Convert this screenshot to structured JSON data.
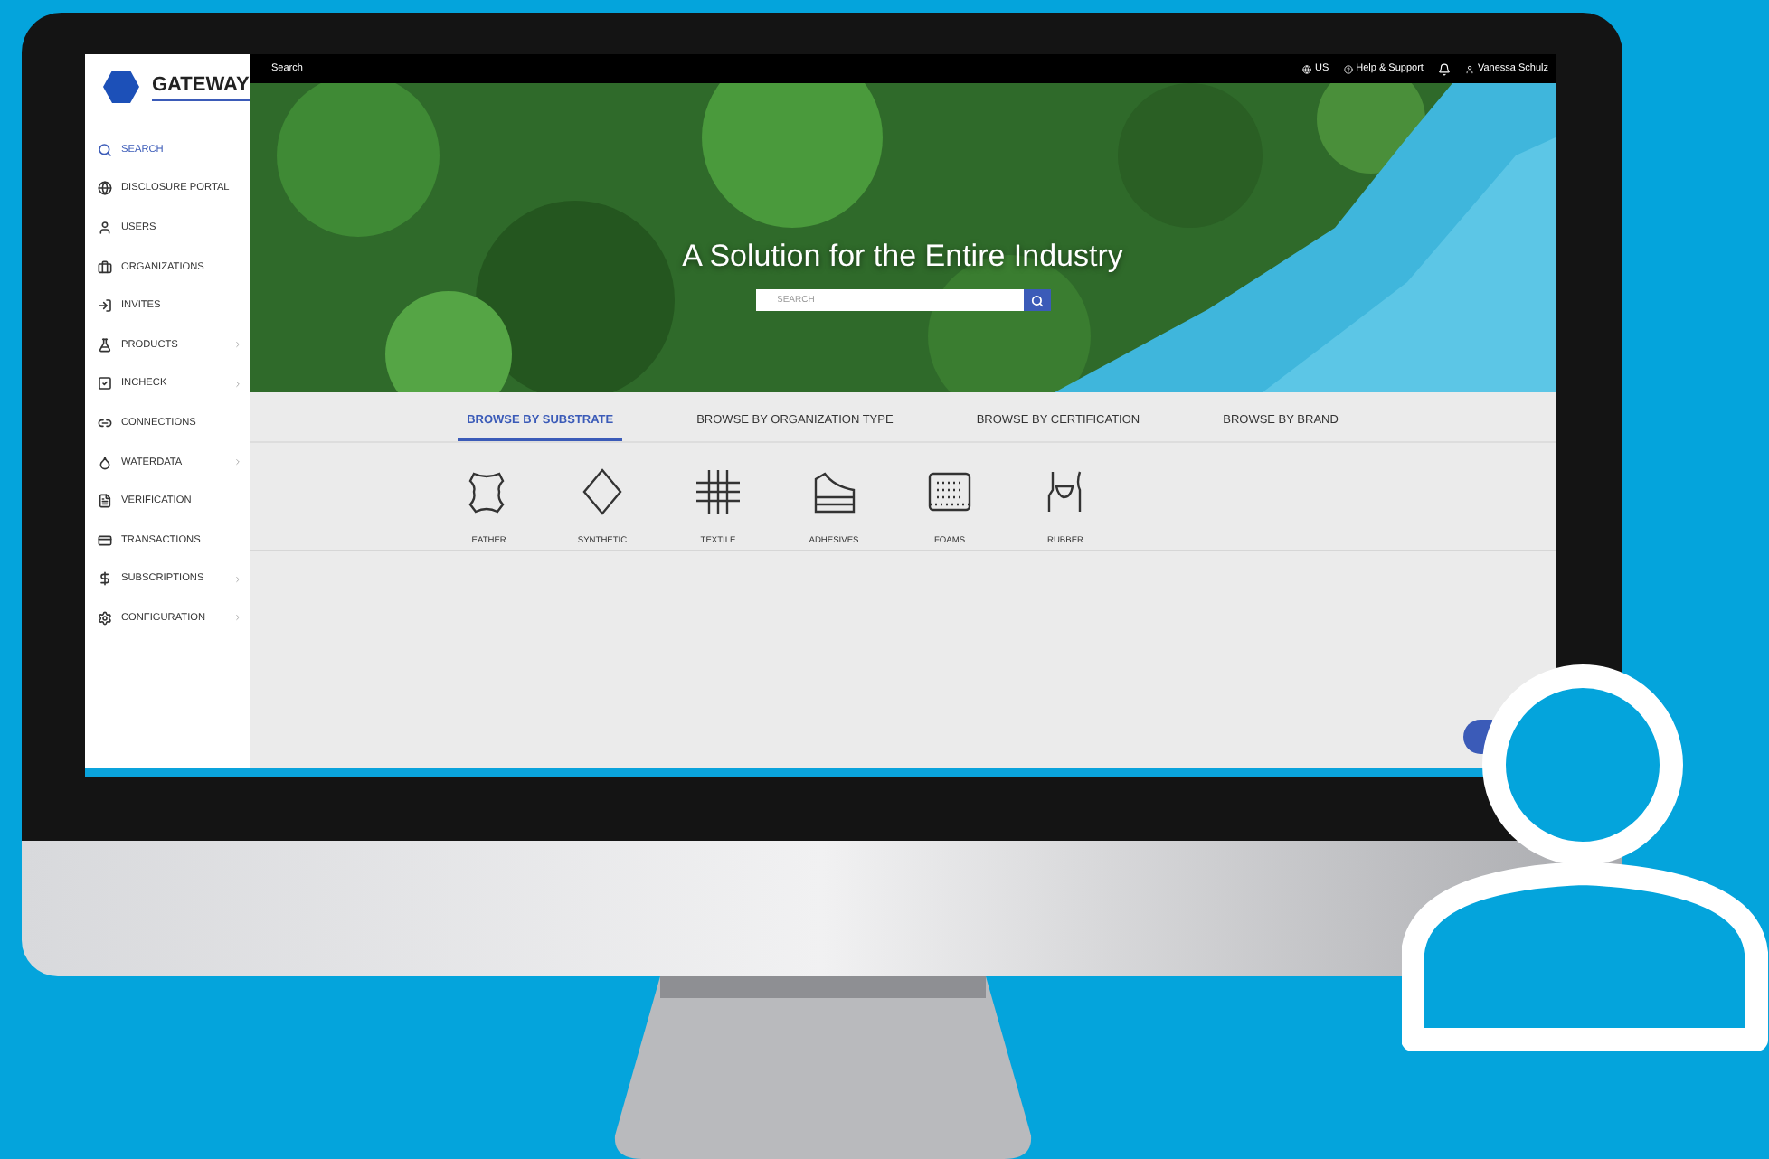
{
  "sidebar": {
    "logo": "GATEWAY",
    "items": [
      {
        "label": "SEARCH",
        "selected": true,
        "submenu": false
      },
      {
        "label": "DISCLOSURE PORTAL",
        "selected": false,
        "submenu": false
      },
      {
        "label": "USERS",
        "selected": false,
        "submenu": false
      },
      {
        "label": "ORGANIZATIONS",
        "selected": false,
        "submenu": false
      },
      {
        "label": "INVITES",
        "selected": false,
        "submenu": false
      },
      {
        "label": "PRODUCTS",
        "selected": false,
        "submenu": true
      },
      {
        "label": "INCHECK",
        "selected": false,
        "submenu": true
      },
      {
        "label": "CONNECTIONS",
        "selected": false,
        "submenu": false
      },
      {
        "label": "WATERDATA",
        "selected": false,
        "submenu": true
      },
      {
        "label": "VERIFICATION",
        "selected": false,
        "submenu": false
      },
      {
        "label": "TRANSACTIONS",
        "selected": false,
        "submenu": false
      },
      {
        "label": "SUBSCRIPTIONS",
        "selected": false,
        "submenu": true
      },
      {
        "label": "CONFIGURATION",
        "selected": false,
        "submenu": true
      }
    ]
  },
  "topbar": {
    "title": "Search",
    "region": "US",
    "help": "Help & Support",
    "user": "Vanessa Schulz"
  },
  "hero": {
    "heading": "A Solution for the Entire Industry",
    "search": {
      "placeholder": "SEARCH"
    }
  },
  "tabs": [
    {
      "label": "BROWSE BY SUBSTRATE",
      "selected": true
    },
    {
      "label": "BROWSE BY ORGANIZATION TYPE",
      "selected": false
    },
    {
      "label": "BROWSE BY CERTIFICATION",
      "selected": false
    },
    {
      "label": "BROWSE BY BRAND",
      "selected": false
    }
  ],
  "substrates": [
    {
      "label": "LEATHER",
      "kind": "leather"
    },
    {
      "label": "SYNTHETIC",
      "kind": "synthetic"
    },
    {
      "label": "TEXTILE",
      "kind": "textile"
    },
    {
      "label": "ADHESIVES",
      "kind": "adhesives"
    },
    {
      "label": "FOAMS",
      "kind": "foams"
    },
    {
      "label": "RUBBER",
      "kind": "rubber"
    }
  ]
}
